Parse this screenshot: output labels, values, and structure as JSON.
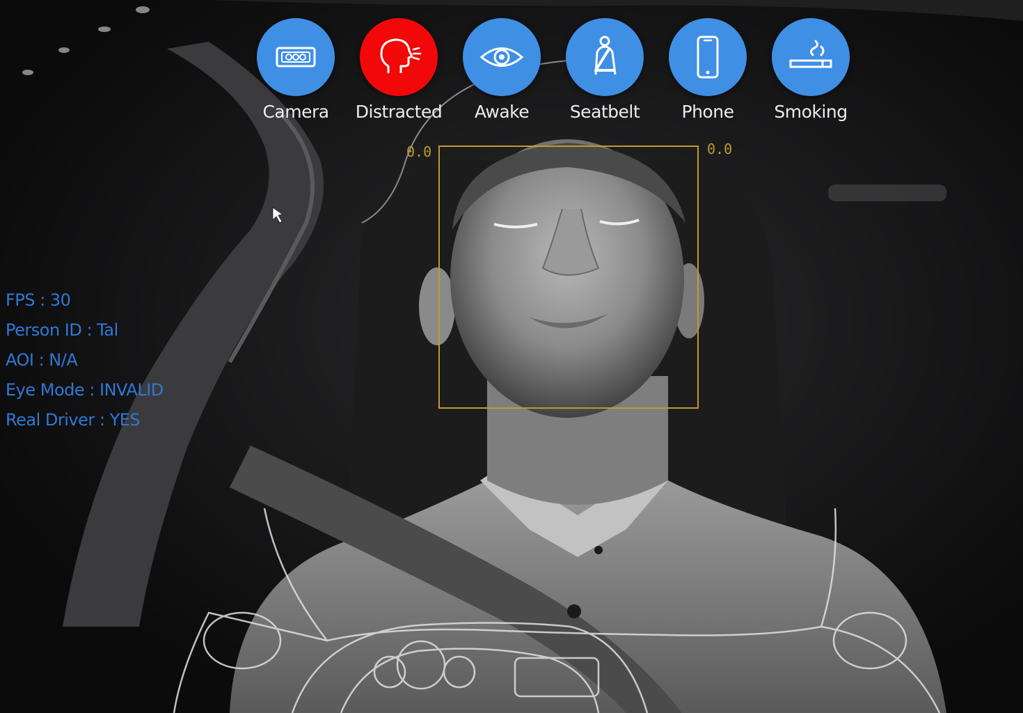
{
  "indicators": [
    {
      "label": "Camera",
      "icon": "camera-module-icon",
      "color": "#3f8fe5"
    },
    {
      "label": "Distracted",
      "icon": "distracted-head-icon",
      "color": "#f20808"
    },
    {
      "label": "Awake",
      "icon": "eye-icon",
      "color": "#3f8fe5"
    },
    {
      "label": "Seatbelt",
      "icon": "seatbelt-icon",
      "color": "#3f8fe5"
    },
    {
      "label": "Phone",
      "icon": "phone-icon",
      "color": "#3f8fe5"
    },
    {
      "label": "Smoking",
      "icon": "cigarette-icon",
      "color": "#3f8fe5"
    }
  ],
  "telemetry": [
    "FPS : 30",
    "Person ID : Tal",
    "AOI : N/A",
    "Eye Mode : INVALID",
    "Real Driver : YES"
  ],
  "face_box": {
    "score_left": "0.0",
    "score_right": "0.0",
    "color": "#c19a2c"
  }
}
